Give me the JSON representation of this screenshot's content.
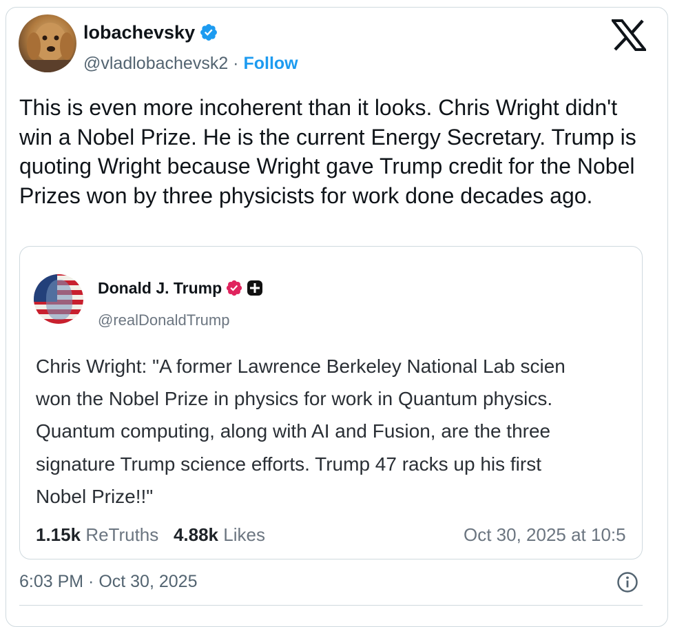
{
  "author": {
    "name": "lobachevsky",
    "handle": "@vladlobachevsk2",
    "separator": "·",
    "follow_label": "Follow",
    "verified_color": "#1d9bf0"
  },
  "tweet": {
    "text": "This is even more incoherent than it looks. Chris Wright didn't win a Nobel Prize. He is the current Energy Secretary. Trump is quoting Wright because Wright gave Trump credit for the Nobel Prizes won by three physicists for work done decades ago.",
    "timestamp": "6:03 PM · Oct 30, 2025"
  },
  "quote": {
    "name": "Donald J. Trump",
    "handle": "@realDonaldTrump",
    "verified_color": "#e0245e",
    "lines": [
      "Chris Wright: \"A former Lawrence Berkeley National Lab scien",
      "won the Nobel Prize in physics for work in Quantum physics.",
      "Quantum computing, along with AI and Fusion, are the three",
      "signature Trump science efforts. Trump 47 racks up his first",
      "Nobel Prize!!\""
    ],
    "retruths_count": "1.15k",
    "retruths_label": "ReTruths",
    "likes_count": "4.88k",
    "likes_label": "Likes",
    "date": "Oct 30, 2025 at 10:5"
  },
  "icons": {
    "verified": "verified-badge-icon",
    "x_logo": "x-logo-icon",
    "info": "info-icon",
    "plus": "plus-badge-icon"
  }
}
